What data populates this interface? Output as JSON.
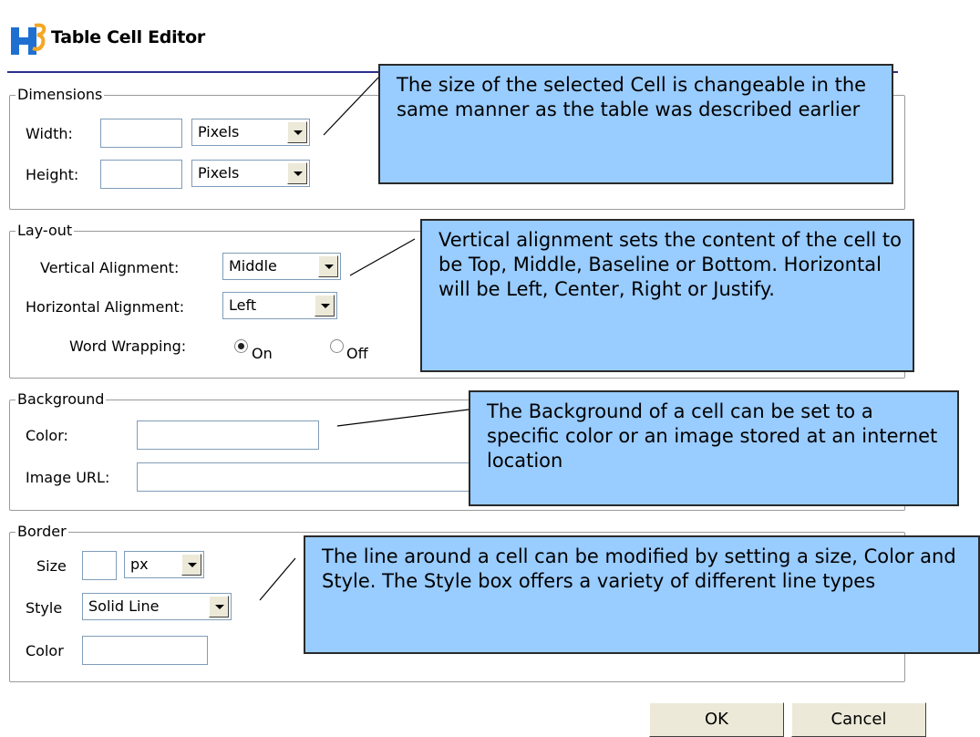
{
  "dialog": {
    "title": "Table Cell Editor"
  },
  "dimensions": {
    "legend": "Dimensions",
    "width_label": "Width:",
    "width_value": "",
    "width_unit": "Pixels",
    "height_label": "Height:",
    "height_value": "",
    "height_unit": "Pixels"
  },
  "layout": {
    "legend": "Lay-out",
    "vertical_label": "Vertical Alignment:",
    "vertical_value": "Middle",
    "horizontal_label": "Horizontal Alignment:",
    "horizontal_value": "Left",
    "wrap_label": "Word Wrapping:",
    "wrap_on_label": "On",
    "wrap_off_label": "Off",
    "wrap_selected": "On"
  },
  "background": {
    "legend": "Background",
    "color_label": "Color:",
    "color_value": "",
    "image_label": "Image URL:",
    "image_value": ""
  },
  "border": {
    "legend": "Border",
    "size_label": "Size",
    "size_value": "",
    "size_unit": "px",
    "style_label": "Style",
    "style_value": "Solid Line",
    "color_label": "Color",
    "color_value": ""
  },
  "buttons": {
    "ok": "OK",
    "cancel": "Cancel"
  },
  "callouts": {
    "dimensions": "The size of the selected Cell is changeable in the same manner as the table was described earlier",
    "layout": "Vertical alignment sets the content of the cell to be Top, Middle, Baseline or Bottom. Horizontal will be Left, Center, Right or Justify.",
    "background": "The Background of a cell can be set to a specific color or an image stored at an internet location",
    "border": "The line around a cell can be modified by setting a size, Color and Style.  The Style box offers a variety of different line types"
  },
  "colors": {
    "callout_fill": "#99ccff",
    "header_rule": "#2b2f8c",
    "logo_blue": "#1f6fd1",
    "logo_orange": "#f5a623"
  },
  "icons": {
    "logo": "h3-logo-icon"
  }
}
